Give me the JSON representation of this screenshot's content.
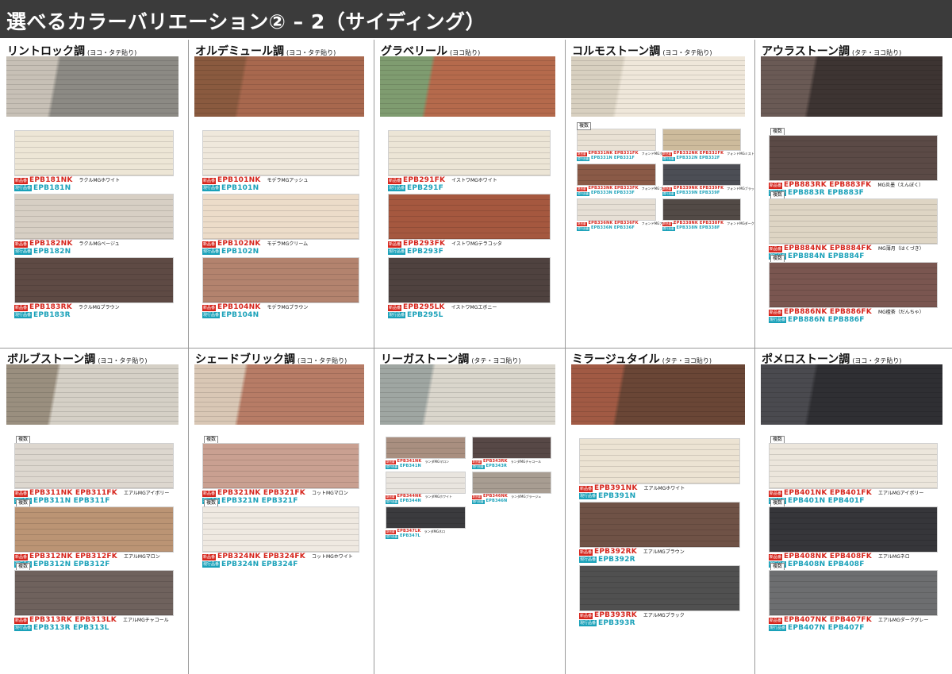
{
  "page_title": "選べるカラーバリエーション② – 2（サイディング）",
  "multi_label": "複数",
  "new_label": "新品番",
  "old_label": "現行品番",
  "sections": [
    {
      "title": "リントロック調",
      "sub": "(ヨコ・タテ貼り)",
      "samples": [
        {
          "color": "#ede6d6",
          "new": "EPB181NK",
          "old": "EPB181N",
          "name": "ラクルMGホワイト"
        },
        {
          "color": "#d7cfc4",
          "new": "EPB182NK",
          "old": "EPB182N",
          "name": "ラクルMGベージュ"
        },
        {
          "color": "#5e4a44",
          "new": "EPB183RK",
          "old": "EPB183R",
          "name": "ラクルMGブラウン"
        }
      ]
    },
    {
      "title": "オルデミュール調",
      "sub": "(ヨコ・タテ貼り)",
      "samples": [
        {
          "color": "#efe8dc",
          "new": "EPB101NK",
          "old": "EPB101N",
          "name": "モデラMGアッシュ"
        },
        {
          "color": "#ecdcc9",
          "new": "EPB102NK",
          "old": "EPB102N",
          "name": "モデラMGクリーム"
        },
        {
          "color": "#b3836e",
          "new": "EPB104NK",
          "old": "EPB104N",
          "name": "モデラMGブラウン"
        }
      ]
    },
    {
      "title": "グラベリール",
      "sub": "(ヨコ貼り)",
      "samples": [
        {
          "color": "#ece5d6",
          "new": "EPB291FK",
          "old": "EPB291F",
          "name": "イストワMGホワイト"
        },
        {
          "color": "#a5583f",
          "new": "EPB293FK",
          "old": "EPB293F",
          "name": "イストワMGテラコッタ"
        },
        {
          "color": "#4f423f",
          "new": "EPB295LK",
          "old": "EPB295L",
          "name": "イストワMGエボニー"
        }
      ]
    },
    {
      "title": "コルモストーン調",
      "sub": "(ヨコ・タテ貼り)",
      "samples": [
        {
          "color": "#e9e1d4",
          "new": "EPB331NK  EPB331FK",
          "old": "EPB331N  EPB331F",
          "name": "フォンドMGホワイト"
        },
        {
          "color": "#cdbb9c",
          "new": "EPB332NK  EPB332FK",
          "old": "EPB332N  EPB332F",
          "name": "フォンドMGミスト"
        },
        {
          "color": "#8a5a47",
          "new": "EPB333NK  EPB333FK",
          "old": "EPB333N  EPB333F",
          "name": "フォンドMGブラウン"
        },
        {
          "color": "#4c4e55",
          "new": "EPB339NK  EPB339FK",
          "old": "EPB339N  EPB339F",
          "name": "フォンドMGブラック"
        },
        {
          "color": "#e6dfd5",
          "new": "EPB336NK  EPB336FK",
          "old": "EPB336N  EPB336F",
          "name": "フォンドMGアイボリー"
        },
        {
          "color": "#524a46",
          "new": "EPB338NK  EPB338FK",
          "old": "EPB338N  EPB338F",
          "name": "フォンドMGダークブラウン"
        }
      ]
    },
    {
      "title": "アウラストーン調",
      "sub": "(タテ・ヨコ貼り)",
      "samples": [
        {
          "color": "#5b4a46",
          "new": "EPB883RK  EPB883FK",
          "old": "EPB883R  EPB883F",
          "name": "MG炎墨（えんぼく）"
        },
        {
          "color": "#ded5c4",
          "new": "EPB884NK  EPB884FK",
          "old": "EPB884N  EPB884F",
          "name": "MG薄月（はくづき）"
        },
        {
          "color": "#7a5650",
          "new": "EPB886NK  EPB886FK",
          "old": "EPB886N  EPB886F",
          "name": "MG檀茶（だんちゃ）"
        }
      ]
    },
    {
      "title": "ボルブストーン調",
      "sub": "(ヨコ・タテ貼り)",
      "samples": [
        {
          "color": "#ddd7cf",
          "new": "EPB311NK  EPB311FK",
          "old": "EPB311N  EPB311F",
          "name": "エアルMGアイボリー"
        },
        {
          "color": "#bb9474",
          "new": "EPB312NK  EPB312FK",
          "old": "EPB312N  EPB312F",
          "name": "エアルMGマロン"
        },
        {
          "color": "#6f625d",
          "new": "EPB313RK  EPB313LK",
          "old": "EPB313R  EPB313L",
          "name": "エアルMGチャコール"
        }
      ]
    },
    {
      "title": "シェードブリック調",
      "sub": "(ヨコ・タテ貼り)",
      "samples": [
        {
          "color": "#c9a091",
          "new": "EPB321NK  EPB321FK",
          "old": "EPB321N  EPB321F",
          "name": "コットMGマロン"
        },
        {
          "color": "#efe9e1",
          "new": "EPB324NK  EPB324FK",
          "old": "EPB324N  EPB324F",
          "name": "コットMGホワイト"
        }
      ]
    },
    {
      "title": "リーガストーン調",
      "sub": "(タテ・ヨコ貼り)",
      "samples": [
        {
          "color": "#a98f80",
          "new": "EPB341NK",
          "old": "EPB341N",
          "name": "ランダMGマロン"
        },
        {
          "color": "#574846",
          "new": "EPB343RK",
          "old": "EPB343R",
          "name": "ランダMGチャコール"
        },
        {
          "color": "#e9e5df",
          "new": "EPB344NK",
          "old": "EPB344N",
          "name": "ランダMGホワイト"
        },
        {
          "color": "#a89d92",
          "new": "EPB346NK",
          "old": "EPB346N",
          "name": "ランダMGブラージュ"
        },
        {
          "color": "#3b3b3e",
          "new": "EPB347LK",
          "old": "EPB347L",
          "name": "ランダMGネロ"
        }
      ]
    },
    {
      "title": "ミラージュタイル",
      "sub": "(タテ・ヨコ貼り)",
      "samples": [
        {
          "color": "#ece3d3",
          "new": "EPB391NK",
          "old": "EPB391N",
          "name": "エアルMGホワイト"
        },
        {
          "color": "#6f5246",
          "new": "EPB392RK",
          "old": "EPB392R",
          "name": "エアルMGブラウン"
        },
        {
          "color": "#505050",
          "new": "EPB393RK",
          "old": "EPB393R",
          "name": "エアルMGブラック"
        }
      ]
    },
    {
      "title": "ポメロストーン調",
      "sub": "(ヨコ・タテ貼り)",
      "samples": [
        {
          "color": "#ece6dc",
          "new": "EPB401NK  EPB401FK",
          "old": "EPB401N  EPB401F",
          "name": "エアルMGアイボリー"
        },
        {
          "color": "#36363a",
          "new": "EPB408NK  EPB408FK",
          "old": "EPB408N  EPB408F",
          "name": "エアルMGネロ"
        },
        {
          "color": "#6d6e70",
          "new": "EPB407NK  EPB407FK",
          "old": "EPB407N  EPB407F",
          "name": "エアルMGダークグレー"
        }
      ]
    }
  ]
}
